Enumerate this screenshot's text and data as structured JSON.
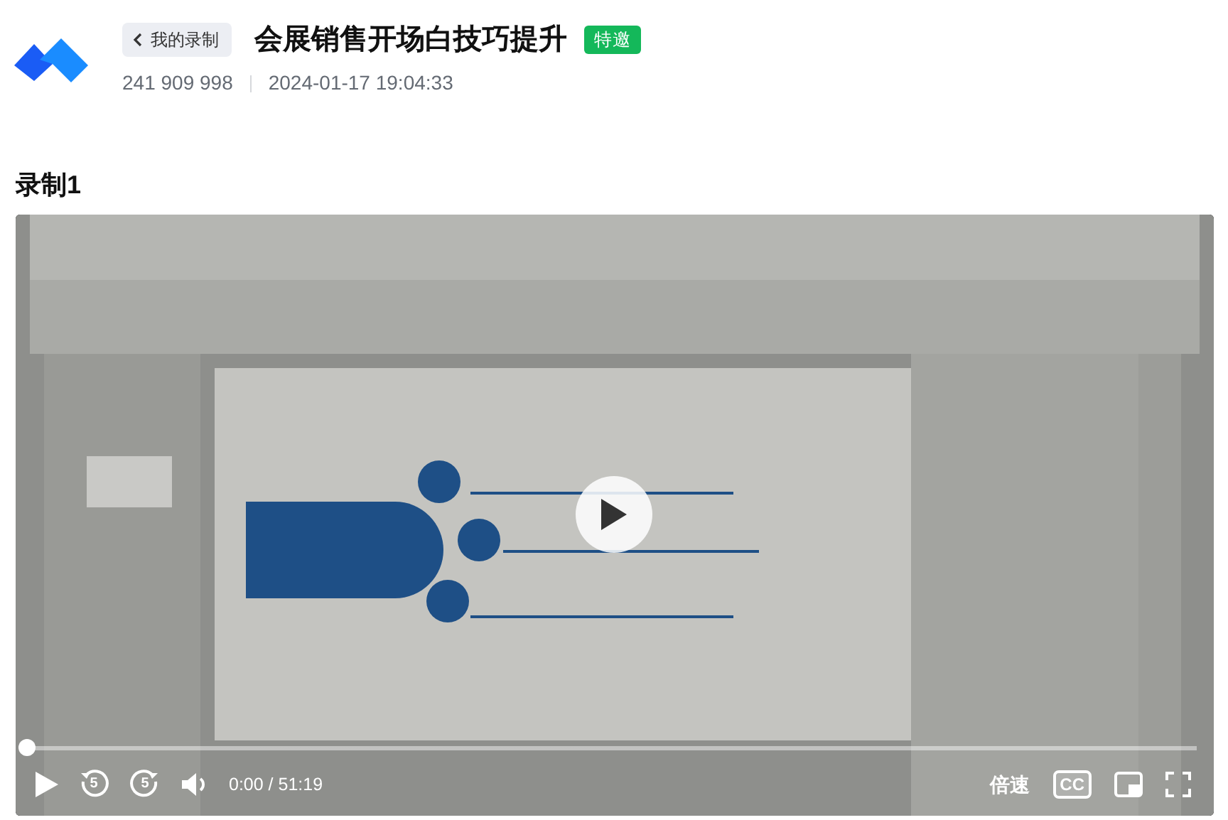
{
  "header": {
    "back_label": "我的录制",
    "title": "会展销售开场白技巧提升",
    "badge": "特邀",
    "meeting_id": "241 909 998",
    "datetime": "2024-01-17 19:04:33"
  },
  "section_title": "录制1",
  "player": {
    "playing": false,
    "progress": {
      "level": 0
    },
    "rewind_seconds": "5",
    "forward_seconds": "5",
    "time": "0:00 / 51:19",
    "speed_label": "倍速",
    "cc_label": "CC"
  }
}
